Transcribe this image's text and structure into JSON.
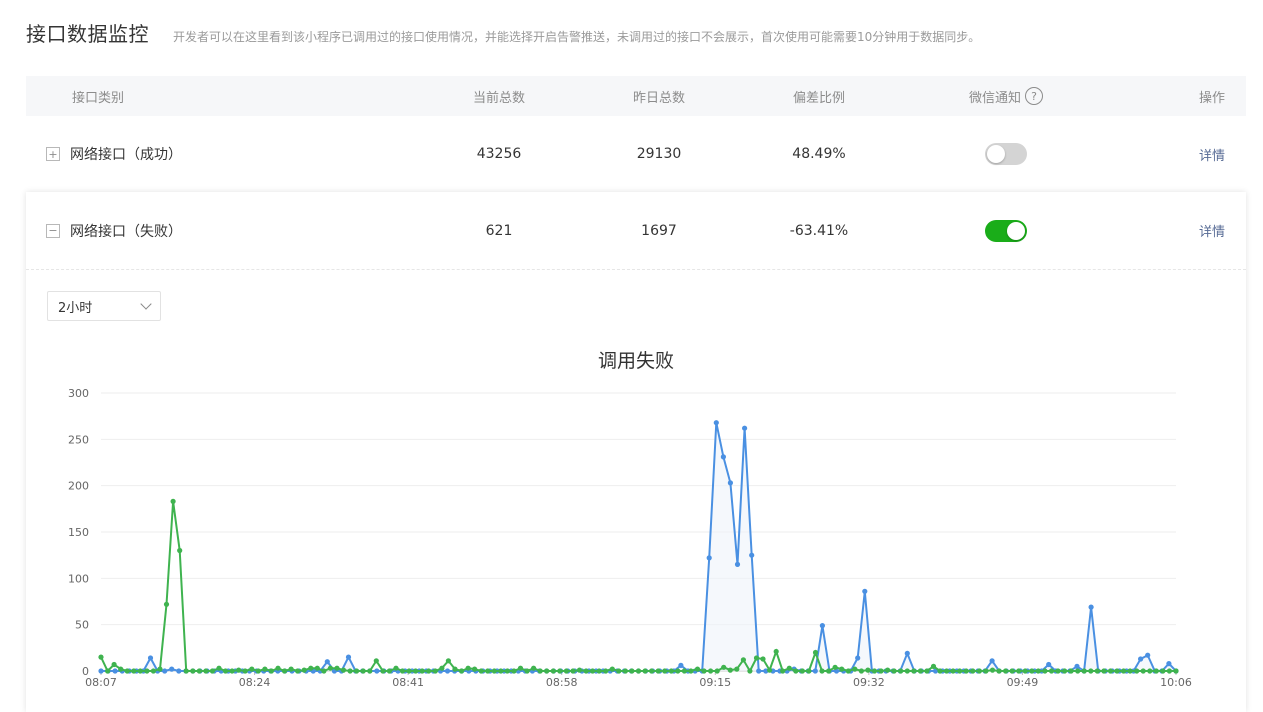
{
  "header": {
    "title": "接口数据监控",
    "description": "开发者可以在这里看到该小程序已调用过的接口使用情况，并能选择开启告警推送，未调用过的接口不会展示，首次使用可能需要10分钟用于数据同步。"
  },
  "table": {
    "columns": {
      "type": "接口类别",
      "current": "当前总数",
      "yesterday": "昨日总数",
      "deviation": "偏差比例",
      "notify": "微信通知",
      "help": "?",
      "op": "操作"
    },
    "rows": [
      {
        "expander": "+",
        "name": "网络接口（成功）",
        "current": "43256",
        "yesterday": "29130",
        "deviation": "48.49%",
        "notify_on": false,
        "op": "详情"
      },
      {
        "expander": "−",
        "name": "网络接口（失败）",
        "current": "621",
        "yesterday": "1697",
        "deviation": "-63.41%",
        "notify_on": true,
        "op": "详情"
      }
    ]
  },
  "range_select": {
    "value": "2小时"
  },
  "colors": {
    "blue": "#4a90e2",
    "green": "#3fb34f",
    "toggle_on": "#1aad19",
    "link": "#576b95"
  },
  "chart_data": {
    "type": "line",
    "title": "调用失败",
    "ylim": [
      0,
      300
    ],
    "yticks": [
      0,
      50,
      100,
      150,
      200,
      250,
      300
    ],
    "xticks": [
      "08:07",
      "08:24",
      "08:41",
      "08:58",
      "09:15",
      "09:32",
      "09:49",
      "10:06"
    ],
    "grid": true,
    "series": [
      {
        "color": "#4a90e2",
        "values": [
          0,
          0,
          0,
          0,
          0,
          0,
          0,
          14,
          0,
          0,
          2,
          0,
          0,
          0,
          0,
          0,
          0,
          0,
          0,
          0,
          0,
          0,
          0,
          0,
          0,
          0,
          0,
          0,
          0,
          0,
          0,
          0,
          10,
          0,
          0,
          15,
          0,
          0,
          0,
          0,
          0,
          0,
          0,
          0,
          0,
          0,
          0,
          0,
          0,
          0,
          0,
          0,
          0,
          0,
          0,
          0,
          0,
          0,
          0,
          0,
          0,
          0,
          0,
          0,
          0,
          0,
          0,
          0,
          0,
          0,
          0,
          0,
          0,
          0,
          0,
          0,
          0,
          0,
          0,
          0,
          0,
          0,
          6,
          0,
          0,
          0,
          122,
          268,
          231,
          203,
          115,
          262,
          125,
          0,
          0,
          0,
          0,
          0,
          2,
          0,
          0,
          0,
          49,
          0,
          0,
          0,
          0,
          14,
          86,
          0,
          0,
          0,
          0,
          0,
          19,
          0,
          0,
          0,
          0,
          0,
          0,
          0,
          0,
          0,
          0,
          0,
          11,
          0,
          0,
          0,
          0,
          0,
          0,
          0,
          7,
          0,
          0,
          0,
          5,
          0,
          69,
          0,
          0,
          0,
          0,
          0,
          0,
          13,
          17,
          0,
          0,
          8,
          0
        ]
      },
      {
        "color": "#3fb34f",
        "values": [
          15,
          0,
          7,
          2,
          0,
          0,
          0,
          0,
          0,
          2,
          72,
          183,
          130,
          0,
          0,
          0,
          0,
          0,
          3,
          0,
          0,
          1,
          0,
          2,
          0,
          2,
          0,
          3,
          0,
          2,
          0,
          1,
          3,
          3,
          0,
          3,
          3,
          1,
          0,
          0,
          0,
          0,
          11,
          0,
          0,
          3,
          0,
          0,
          0,
          0,
          0,
          0,
          3,
          11,
          2,
          0,
          3,
          2,
          0,
          0,
          0,
          0,
          0,
          0,
          3,
          0,
          3,
          0,
          0,
          0,
          0,
          0,
          0,
          1,
          0,
          0,
          0,
          0,
          2,
          0,
          0,
          0,
          0,
          0,
          0,
          0,
          0,
          0,
          0,
          0,
          0,
          2,
          0,
          0,
          0,
          4,
          1,
          2,
          12,
          0,
          14,
          13,
          1,
          21,
          0,
          3,
          0,
          0,
          0,
          20,
          0,
          0,
          4,
          2,
          0,
          2,
          0,
          1,
          0,
          0,
          1,
          0,
          0,
          0,
          0,
          0,
          0,
          5,
          0,
          0,
          0,
          0,
          0,
          0,
          0,
          0,
          1,
          0,
          0,
          0,
          0,
          0,
          0,
          0,
          0,
          0,
          0,
          0,
          0,
          0,
          0,
          0,
          0,
          0,
          0,
          0,
          0,
          0,
          0,
          0,
          0,
          0,
          0,
          0,
          0
        ]
      }
    ]
  }
}
